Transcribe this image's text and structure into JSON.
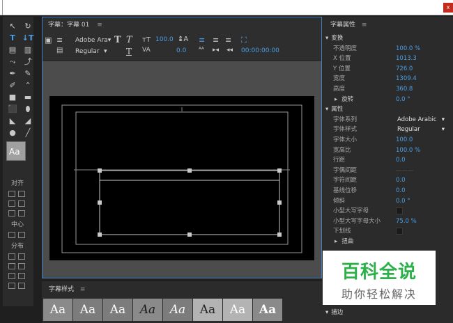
{
  "window": {
    "close_label": "x"
  },
  "title_panel": {
    "title": "字幕：字幕 01",
    "menu_icon": "≡",
    "font_family": "Adobe Ara▾",
    "font_style": "Regular",
    "font_size": "100.0",
    "tracking": "0.0",
    "timecode": "00:00:00:00"
  },
  "styles_panel": {
    "title": "字幕样式",
    "menu_icon": "≡",
    "swatches": [
      "Aa",
      "Aa",
      "Aa",
      "Aa",
      "Aa",
      "Aa",
      "Aa",
      "Aa"
    ]
  },
  "tools": {
    "align_label": "对齐",
    "center_label": "中心",
    "distribute_label": "分布",
    "style_preview": "Aa"
  },
  "props": {
    "title": "字幕属性",
    "menu_icon": "≡",
    "transform_label": "变换",
    "opacity_label": "不透明度",
    "opacity_value": "100.0 %",
    "x_label": "X 位置",
    "x_value": "1013.3",
    "y_label": "Y 位置",
    "y_value": "726.0",
    "width_label": "宽度",
    "width_value": "1309.4",
    "height_label": "高度",
    "height_value": "360.8",
    "rotation_label": "旋转",
    "rotation_value": "0.0 °",
    "properties_label": "属性",
    "font_family_label": "字体系列",
    "font_family_value": "Adobe Arabic",
    "font_style_label": "字体样式",
    "font_style_value": "Regular",
    "font_size_label": "字体大小",
    "font_size_value": "100.0",
    "aspect_label": "宽高比",
    "aspect_value": "100.0 %",
    "leading_label": "行距",
    "leading_value": "0.0",
    "kerning_label": "字偶间距",
    "tracking_label": "字符间距",
    "tracking_value": "0.0",
    "baseline_label": "基线位移",
    "baseline_value": "0.0",
    "slant_label": "倾斜",
    "slant_value": "0.0 °",
    "smallcaps_label": "小型大写字母",
    "smallcaps_size_label": "小型大写字母大小",
    "smallcaps_size_value": "75.0 %",
    "underline_label": "下划线",
    "distort_label": "扭曲",
    "stroke_label": "描边"
  },
  "watermark": {
    "logo": "百科全说",
    "sub": "助你轻松解决"
  }
}
